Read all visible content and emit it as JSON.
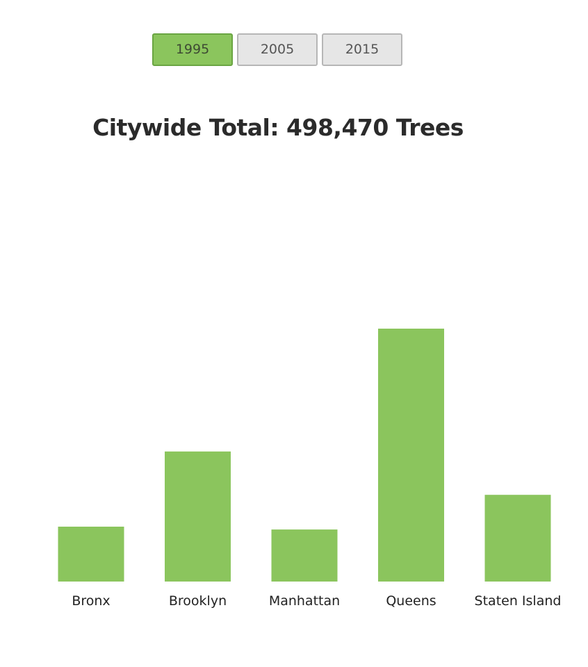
{
  "toggle": {
    "years": [
      "1995",
      "2005",
      "2015"
    ],
    "active": "1995"
  },
  "colors": {
    "bar": "#8bc55d",
    "active_button": "#8bc55d",
    "inactive_button": "#e6e6e6"
  },
  "chart_data": {
    "type": "bar",
    "title": "Citywide Total: 498,470 Trees",
    "categories": [
      "Bronx",
      "Brooklyn",
      "Manhattan",
      "Queens",
      "Staten Island"
    ],
    "values": [
      38000,
      90000,
      36000,
      175000,
      60000
    ],
    "xlabel": "",
    "ylabel": "",
    "ylim": [
      0,
      200000
    ],
    "grid": false,
    "legend": "none"
  }
}
